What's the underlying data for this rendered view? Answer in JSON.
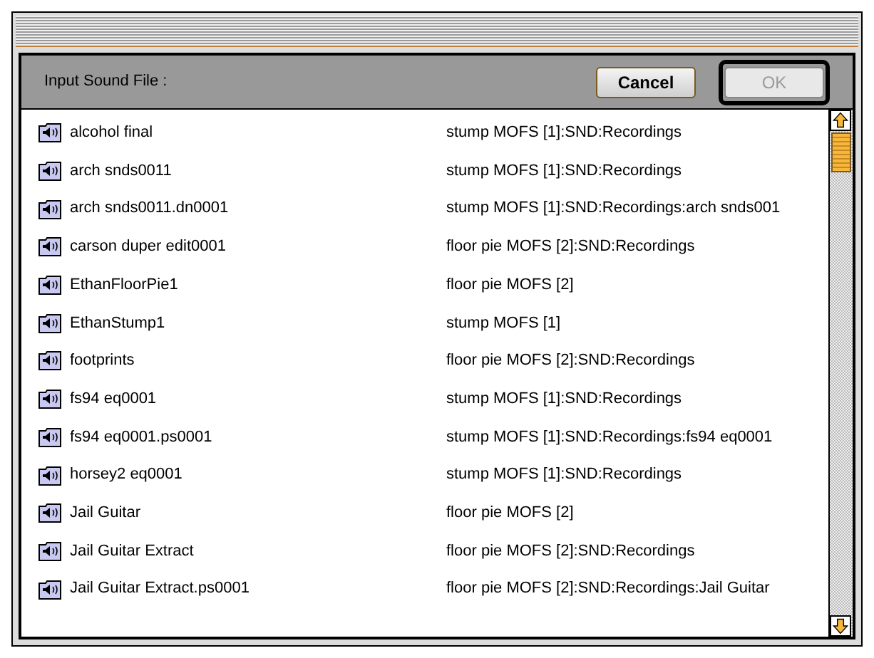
{
  "dialog": {
    "prompt": "Input Sound File :",
    "buttons": [
      {
        "label": "Cancel",
        "default": false,
        "disabled": false
      },
      {
        "label": "OK",
        "default": true,
        "disabled": true
      }
    ]
  },
  "files": [
    {
      "name": "alcohol final",
      "location": "stump MOFS [1]:SND:Recordings"
    },
    {
      "name": "arch snds0011",
      "location": "stump MOFS [1]:SND:Recordings"
    },
    {
      "name": "arch snds0011.dn0001",
      "location": "stump MOFS [1]:SND:Recordings:arch snds001"
    },
    {
      "name": "carson duper edit0001",
      "location": "floor pie MOFS [2]:SND:Recordings"
    },
    {
      "name": "EthanFloorPie1",
      "location": "floor pie MOFS [2]"
    },
    {
      "name": "EthanStump1",
      "location": "stump MOFS [1]"
    },
    {
      "name": "footprints",
      "location": "floor pie MOFS [2]:SND:Recordings"
    },
    {
      "name": "fs94 eq0001",
      "location": "stump MOFS [1]:SND:Recordings"
    },
    {
      "name": "fs94 eq0001.ps0001",
      "location": "stump MOFS [1]:SND:Recordings:fs94 eq0001"
    },
    {
      "name": "horsey2 eq0001",
      "location": "stump MOFS [1]:SND:Recordings"
    },
    {
      "name": "Jail Guitar",
      "location": "floor pie MOFS [2]"
    },
    {
      "name": "Jail Guitar Extract",
      "location": "floor pie MOFS [2]:SND:Recordings"
    },
    {
      "name": "Jail Guitar Extract.ps0001",
      "location": "floor pie MOFS [2]:SND:Recordings:Jail Guitar"
    }
  ]
}
